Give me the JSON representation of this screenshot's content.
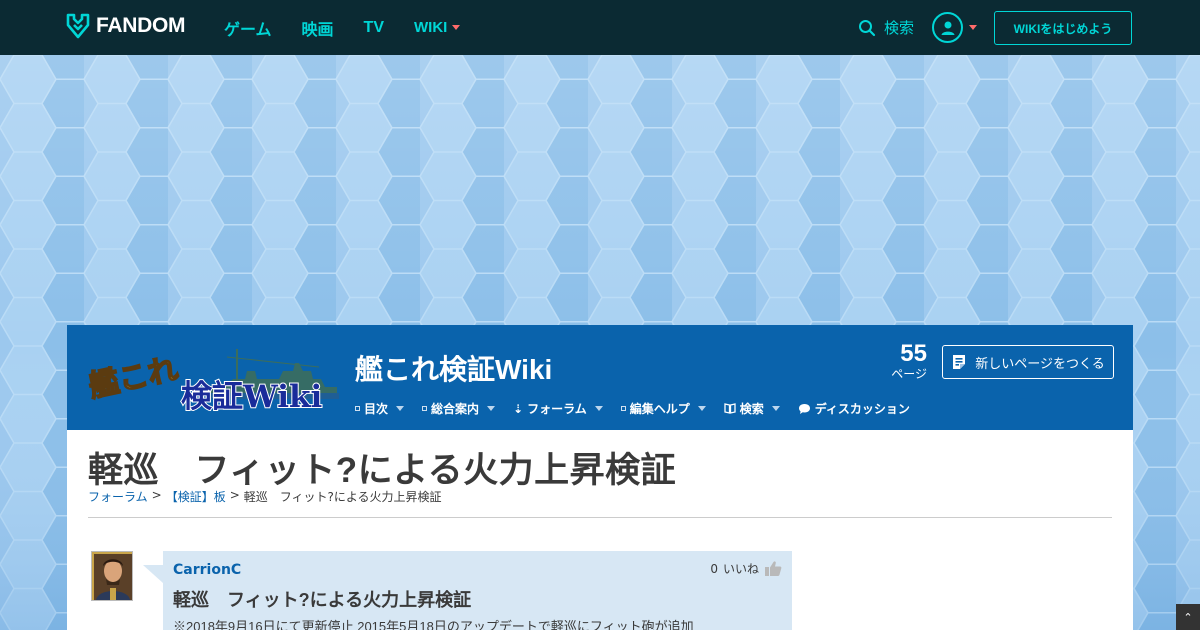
{
  "global_nav": {
    "brand": "FANDOM",
    "links": [
      "ゲーム",
      "映画",
      "TV",
      "WIKI"
    ],
    "search_label": "検索",
    "start_wiki_label": "WIKIをはじめよう"
  },
  "wiki": {
    "title": "艦これ検証Wiki",
    "logo_text_line1": "艦これ",
    "logo_text_line2": "検証Wiki",
    "page_count": "55",
    "page_count_label": "ページ",
    "new_page_label": "新しいページをつくる",
    "local_nav": [
      {
        "label": "目次"
      },
      {
        "label": "総合案内"
      },
      {
        "label": "フォーラム"
      },
      {
        "label": "編集ヘルプ"
      },
      {
        "label": "検索"
      },
      {
        "label": "ディスカッション"
      }
    ]
  },
  "article": {
    "heading": "軽巡　フィット?による火力上昇検証",
    "breadcrumb": {
      "crumb1": "フォーラム",
      "sep1": ">",
      "crumb2": "【検証】板",
      "sep2": ">",
      "current": "軽巡　フィット?による火力上昇検証"
    },
    "post": {
      "author": "CarrionC",
      "likes": "0",
      "likes_label": "いいね",
      "title": "軽巡　フィット?による火力上昇検証",
      "body": "※2018年9月16日にて更新停止 2015年5月18日のアップデートで軽巡にフィット砲が追加"
    }
  },
  "colors": {
    "global_nav_bg": "#0b2a33",
    "accent": "#00d6d6",
    "wiki_header_bg": "#0a63ac",
    "post_bg": "#d7e7f4"
  }
}
